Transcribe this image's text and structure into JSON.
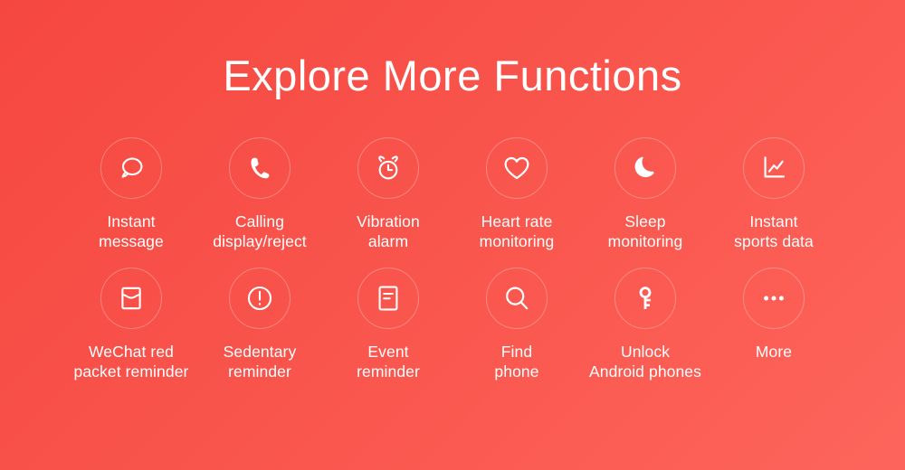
{
  "header": {
    "title": "Explore More Functions"
  },
  "colors": {
    "background_top_left": "#f5473f",
    "background_bottom_right": "#fd655c",
    "foreground": "#ffffff",
    "circle_stroke": "rgba(255,255,255,0.30)"
  },
  "features": {
    "row1": [
      {
        "icon": "chat-bubble-icon",
        "label": "Instant\nmessage"
      },
      {
        "icon": "phone-handset-icon",
        "label": "Calling\ndisplay/reject"
      },
      {
        "icon": "alarm-clock-icon",
        "label": "Vibration\nalarm"
      },
      {
        "icon": "heart-icon",
        "label": "Heart rate\nmonitoring"
      },
      {
        "icon": "crescent-moon-icon",
        "label": "Sleep\nmonitoring"
      },
      {
        "icon": "line-chart-icon",
        "label": "Instant\nsports data"
      }
    ],
    "row2": [
      {
        "icon": "envelope-icon",
        "label": "WeChat red\npacket reminder"
      },
      {
        "icon": "exclamation-circle-icon",
        "label": "Sedentary\nreminder"
      },
      {
        "icon": "document-lines-icon",
        "label": "Event\nreminder"
      },
      {
        "icon": "magnifier-icon",
        "label": "Find\nphone"
      },
      {
        "icon": "key-icon",
        "label": "Unlock\nAndroid phones"
      },
      {
        "icon": "ellipsis-icon",
        "label": "More"
      }
    ]
  }
}
